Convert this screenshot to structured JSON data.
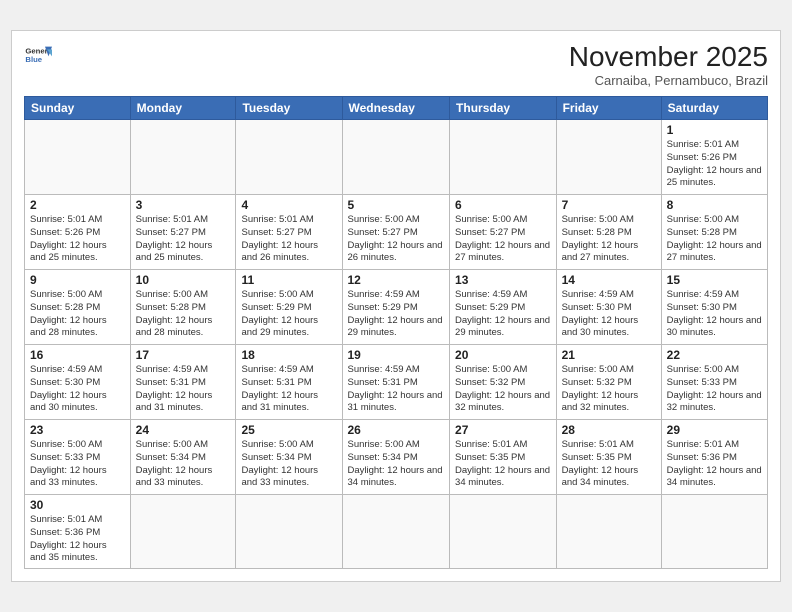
{
  "header": {
    "logo_line1": "General",
    "logo_line2": "Blue",
    "month": "November 2025",
    "location": "Carnaiba, Pernambuco, Brazil"
  },
  "weekdays": [
    "Sunday",
    "Monday",
    "Tuesday",
    "Wednesday",
    "Thursday",
    "Friday",
    "Saturday"
  ],
  "weeks": [
    [
      {
        "day": "",
        "info": ""
      },
      {
        "day": "",
        "info": ""
      },
      {
        "day": "",
        "info": ""
      },
      {
        "day": "",
        "info": ""
      },
      {
        "day": "",
        "info": ""
      },
      {
        "day": "",
        "info": ""
      },
      {
        "day": "1",
        "info": "Sunrise: 5:01 AM\nSunset: 5:26 PM\nDaylight: 12 hours\nand 25 minutes."
      }
    ],
    [
      {
        "day": "2",
        "info": "Sunrise: 5:01 AM\nSunset: 5:26 PM\nDaylight: 12 hours\nand 25 minutes."
      },
      {
        "day": "3",
        "info": "Sunrise: 5:01 AM\nSunset: 5:27 PM\nDaylight: 12 hours\nand 25 minutes."
      },
      {
        "day": "4",
        "info": "Sunrise: 5:01 AM\nSunset: 5:27 PM\nDaylight: 12 hours\nand 26 minutes."
      },
      {
        "day": "5",
        "info": "Sunrise: 5:00 AM\nSunset: 5:27 PM\nDaylight: 12 hours\nand 26 minutes."
      },
      {
        "day": "6",
        "info": "Sunrise: 5:00 AM\nSunset: 5:27 PM\nDaylight: 12 hours\nand 27 minutes."
      },
      {
        "day": "7",
        "info": "Sunrise: 5:00 AM\nSunset: 5:28 PM\nDaylight: 12 hours\nand 27 minutes."
      },
      {
        "day": "8",
        "info": "Sunrise: 5:00 AM\nSunset: 5:28 PM\nDaylight: 12 hours\nand 27 minutes."
      }
    ],
    [
      {
        "day": "9",
        "info": "Sunrise: 5:00 AM\nSunset: 5:28 PM\nDaylight: 12 hours\nand 28 minutes."
      },
      {
        "day": "10",
        "info": "Sunrise: 5:00 AM\nSunset: 5:28 PM\nDaylight: 12 hours\nand 28 minutes."
      },
      {
        "day": "11",
        "info": "Sunrise: 5:00 AM\nSunset: 5:29 PM\nDaylight: 12 hours\nand 29 minutes."
      },
      {
        "day": "12",
        "info": "Sunrise: 4:59 AM\nSunset: 5:29 PM\nDaylight: 12 hours\nand 29 minutes."
      },
      {
        "day": "13",
        "info": "Sunrise: 4:59 AM\nSunset: 5:29 PM\nDaylight: 12 hours\nand 29 minutes."
      },
      {
        "day": "14",
        "info": "Sunrise: 4:59 AM\nSunset: 5:30 PM\nDaylight: 12 hours\nand 30 minutes."
      },
      {
        "day": "15",
        "info": "Sunrise: 4:59 AM\nSunset: 5:30 PM\nDaylight: 12 hours\nand 30 minutes."
      }
    ],
    [
      {
        "day": "16",
        "info": "Sunrise: 4:59 AM\nSunset: 5:30 PM\nDaylight: 12 hours\nand 30 minutes."
      },
      {
        "day": "17",
        "info": "Sunrise: 4:59 AM\nSunset: 5:31 PM\nDaylight: 12 hours\nand 31 minutes."
      },
      {
        "day": "18",
        "info": "Sunrise: 4:59 AM\nSunset: 5:31 PM\nDaylight: 12 hours\nand 31 minutes."
      },
      {
        "day": "19",
        "info": "Sunrise: 4:59 AM\nSunset: 5:31 PM\nDaylight: 12 hours\nand 31 minutes."
      },
      {
        "day": "20",
        "info": "Sunrise: 5:00 AM\nSunset: 5:32 PM\nDaylight: 12 hours\nand 32 minutes."
      },
      {
        "day": "21",
        "info": "Sunrise: 5:00 AM\nSunset: 5:32 PM\nDaylight: 12 hours\nand 32 minutes."
      },
      {
        "day": "22",
        "info": "Sunrise: 5:00 AM\nSunset: 5:33 PM\nDaylight: 12 hours\nand 32 minutes."
      }
    ],
    [
      {
        "day": "23",
        "info": "Sunrise: 5:00 AM\nSunset: 5:33 PM\nDaylight: 12 hours\nand 33 minutes."
      },
      {
        "day": "24",
        "info": "Sunrise: 5:00 AM\nSunset: 5:34 PM\nDaylight: 12 hours\nand 33 minutes."
      },
      {
        "day": "25",
        "info": "Sunrise: 5:00 AM\nSunset: 5:34 PM\nDaylight: 12 hours\nand 33 minutes."
      },
      {
        "day": "26",
        "info": "Sunrise: 5:00 AM\nSunset: 5:34 PM\nDaylight: 12 hours\nand 34 minutes."
      },
      {
        "day": "27",
        "info": "Sunrise: 5:01 AM\nSunset: 5:35 PM\nDaylight: 12 hours\nand 34 minutes."
      },
      {
        "day": "28",
        "info": "Sunrise: 5:01 AM\nSunset: 5:35 PM\nDaylight: 12 hours\nand 34 minutes."
      },
      {
        "day": "29",
        "info": "Sunrise: 5:01 AM\nSunset: 5:36 PM\nDaylight: 12 hours\nand 34 minutes."
      }
    ],
    [
      {
        "day": "30",
        "info": "Sunrise: 5:01 AM\nSunset: 5:36 PM\nDaylight: 12 hours\nand 35 minutes."
      },
      {
        "day": "",
        "info": ""
      },
      {
        "day": "",
        "info": ""
      },
      {
        "day": "",
        "info": ""
      },
      {
        "day": "",
        "info": ""
      },
      {
        "day": "",
        "info": ""
      },
      {
        "day": "",
        "info": ""
      }
    ]
  ]
}
